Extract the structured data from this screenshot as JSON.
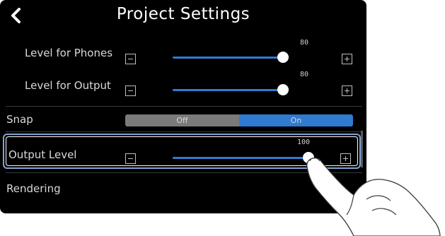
{
  "header": {
    "title": "Project Settings",
    "back_icon": "chevron-left-icon"
  },
  "rows": {
    "level_phones": {
      "label": "Level for Phones",
      "value": "80",
      "fraction": 0.8
    },
    "level_output": {
      "label": "Level for Output",
      "value": "80",
      "fraction": 0.8
    },
    "snap": {
      "label": "Snap",
      "off_label": "Off",
      "on_label": "On",
      "selected": "On"
    },
    "output_level": {
      "label": "Output Level",
      "value": "100",
      "fraction": 1.0
    },
    "rendering": {
      "label": "Rendering"
    }
  },
  "colors": {
    "accent": "#2f7bd1",
    "background": "#000000",
    "focus_border": "#7fa3d6"
  }
}
